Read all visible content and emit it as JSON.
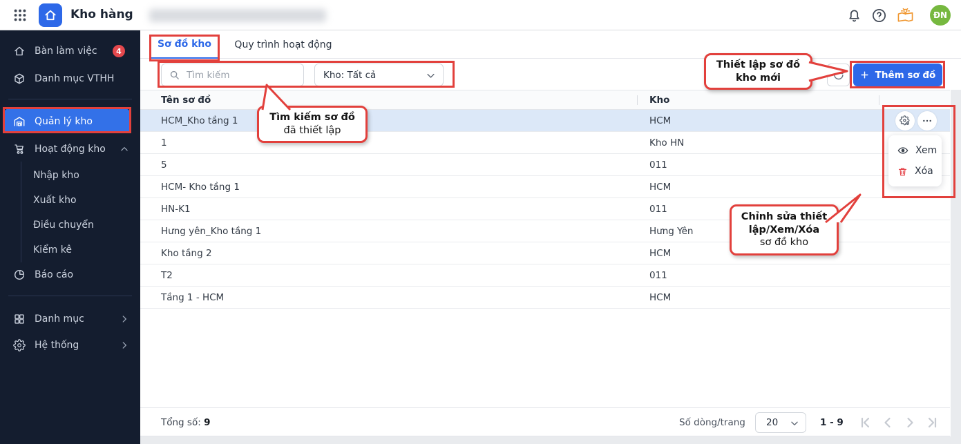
{
  "topbar": {
    "app_title": "Kho hàng",
    "avatar_initials": "ĐN"
  },
  "sidebar": {
    "workspace": "Bàn làm việc",
    "workspace_badge": "4",
    "catalog_vthh": "Danh mục VTHH",
    "warehouse_mgmt": "Quản lý kho",
    "warehouse_ops": "Hoạt động kho",
    "sub_import": "Nhập kho",
    "sub_export": "Xuất kho",
    "sub_transfer": "Điều chuyển",
    "sub_stocktake": "Kiểm kê",
    "reports": "Báo cáo",
    "categories": "Danh mục",
    "system": "Hệ thống"
  },
  "tabs": {
    "layout": "Sơ đồ kho",
    "process": "Quy trình hoạt động"
  },
  "toolbar": {
    "search_placeholder": "Tìm kiếm",
    "warehouse_filter": "Kho: Tất cả",
    "add_label": "Thêm sơ đồ"
  },
  "table": {
    "col_name": "Tên sơ đồ",
    "col_kho": "Kho",
    "rows": [
      {
        "name": "HCM_Kho tầng 1",
        "kho": "HCM"
      },
      {
        "name": "1",
        "kho": "Kho HN"
      },
      {
        "name": "5",
        "kho": "011"
      },
      {
        "name": "HCM- Kho tầng 1",
        "kho": "HCM"
      },
      {
        "name": "HN-K1",
        "kho": "011"
      },
      {
        "name": "Hưng yên_Kho tầng 1",
        "kho": "Hưng Yên"
      },
      {
        "name": "Kho tầng 2",
        "kho": "HCM"
      },
      {
        "name": "T2",
        "kho": "011"
      },
      {
        "name": "Tầng 1 - HCM",
        "kho": "HCM"
      }
    ]
  },
  "row_menu": {
    "view": "Xem",
    "delete": "Xóa"
  },
  "footer": {
    "total_label": "Tổng số:",
    "total_value": "9",
    "per_page_label": "Số dòng/trang",
    "per_page_value": "20",
    "range": "1 - 9"
  },
  "callouts": {
    "add_new": "Thiết lập sơ đồ kho mới",
    "search_bold": "Tìm kiếm sơ đồ",
    "search_regular": "đã thiết lập",
    "actions_bold": "Chỉnh sửa thiết lập/Xem/Xóa",
    "actions_regular": "sơ đồ kho"
  },
  "icons": {
    "app-grid": "waffle 9 dots",
    "app-logo": "home in blue square",
    "notification": "bell",
    "help": "question circle",
    "tips": "open book with lightbulb",
    "search": "magnifier",
    "select-chevron": "chevron down",
    "refresh": "circular arrow",
    "add": "plus",
    "row-settings": "gear with small cog",
    "row-more": "ellipsis",
    "view": "eye",
    "delete": "trash",
    "pagination": "first / prev / next / last"
  },
  "colors": {
    "accent_blue": "#2d68e8",
    "annotation_red": "#e2403c",
    "sidebar_bg": "#141d2f",
    "selected_row": "#dce8f8",
    "badge_red": "#e5484d",
    "avatar_green": "#76b83f",
    "tips_orange": "#f0962e",
    "delete_red": "#e5484d"
  }
}
